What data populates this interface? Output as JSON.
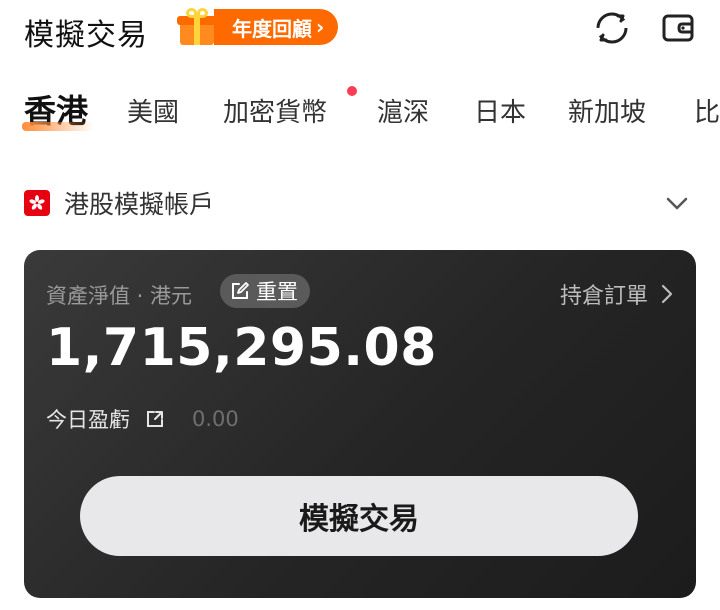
{
  "header": {
    "title": "模擬交易",
    "promo_label": "年度回顧",
    "promo_arrow": "›"
  },
  "tabs": [
    {
      "label": "香港",
      "active": true
    },
    {
      "label": "美國",
      "active": false
    },
    {
      "label": "加密貨幣",
      "active": false,
      "has_dot": true
    },
    {
      "label": "滬深",
      "active": false
    },
    {
      "label": "日本",
      "active": false
    },
    {
      "label": "新加坡",
      "active": false
    },
    {
      "label": "比",
      "active": false
    }
  ],
  "account": {
    "name": "港股模擬帳戶"
  },
  "card": {
    "nav_label": "資產淨值 · 港元",
    "reset_label": "重置",
    "positions_label": "持倉訂單",
    "nav_value": "1,715,295.08",
    "pnl_label": "今日盈虧",
    "pnl_value": "0.00",
    "trade_button_label": "模擬交易"
  },
  "colors": {
    "accent": "#ff6a00",
    "card_bg": "#252525",
    "notif_dot": "#ff3b55",
    "flag_red": "#e60012"
  },
  "icons": {
    "refresh": "refresh-icon",
    "wallet": "wallet-icon",
    "gift": "gift-icon",
    "flag": "hk-flag-icon",
    "chevron": "chevron-down-icon",
    "edit": "edit-icon",
    "share": "share-icon"
  }
}
